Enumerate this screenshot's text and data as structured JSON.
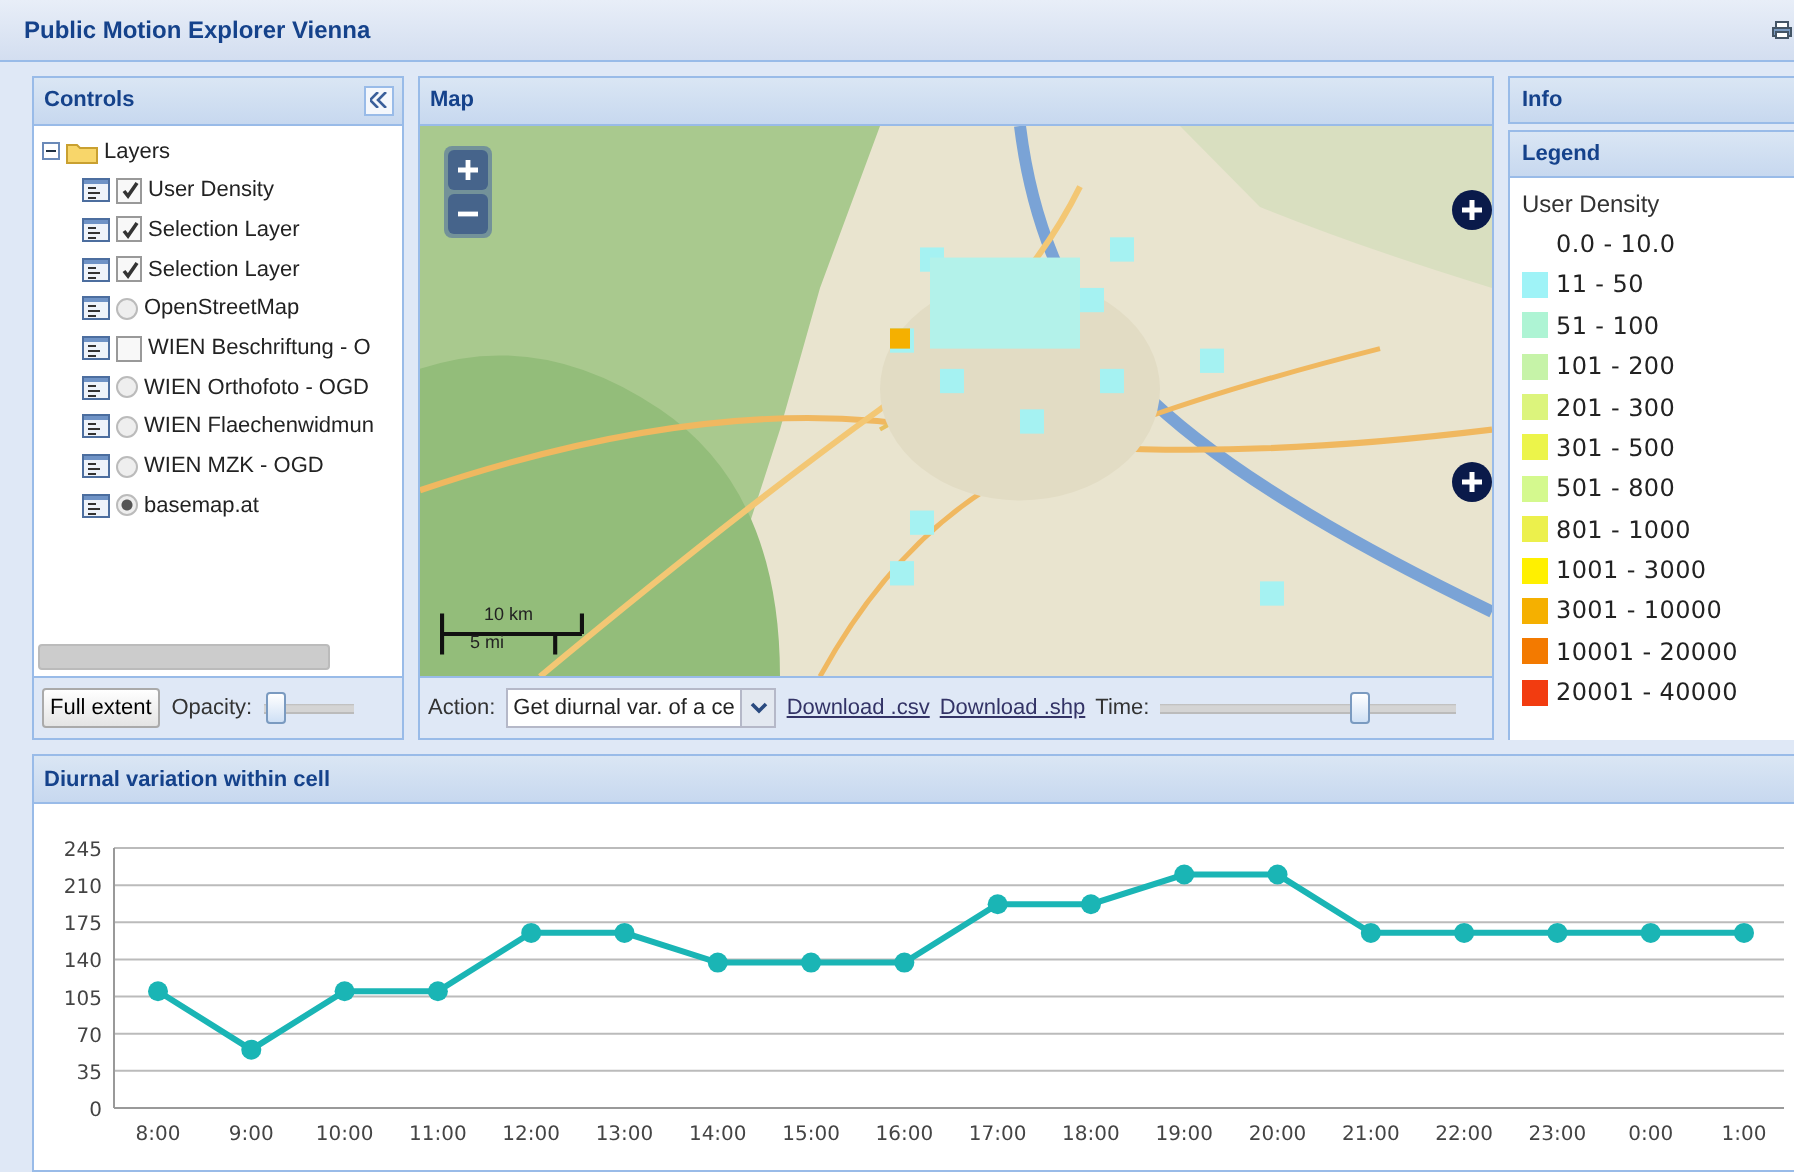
{
  "app_title": "Public Motion Explorer Vienna",
  "controls": {
    "title": "Controls",
    "tree": {
      "label": "Layers",
      "expanded": true,
      "children": [
        {
          "kind": "checkbox",
          "label": "User Density",
          "checked": true
        },
        {
          "kind": "checkbox",
          "label": "Selection Layer",
          "checked": true
        },
        {
          "kind": "checkbox",
          "label": "Selection Layer",
          "checked": true
        },
        {
          "kind": "radio",
          "label": "OpenStreetMap",
          "checked": false
        },
        {
          "kind": "checkbox",
          "label": "WIEN Beschriftung - O",
          "checked": false
        },
        {
          "kind": "radio",
          "label": "WIEN Orthofoto - OGD",
          "checked": false
        },
        {
          "kind": "radio",
          "label": "WIEN Flaechenwidmun",
          "checked": false
        },
        {
          "kind": "radio",
          "label": "WIEN MZK - OGD",
          "checked": false
        },
        {
          "kind": "radio",
          "label": "basemap.at",
          "checked": true
        }
      ]
    },
    "full_extent": "Full extent",
    "opacity_label": "Opacity:",
    "opacity": {
      "level": 0.1
    }
  },
  "map": {
    "title": "Map",
    "scale_km": "10 km",
    "scale_mi": "5 mi",
    "action_label": "Action:",
    "action_value": "Get diurnal var. of a ce",
    "links": [
      "Download .csv",
      "Download .shp"
    ],
    "time_label": "Time:",
    "time": {
      "level": 0.67
    }
  },
  "info": {
    "title": "Info"
  },
  "legend": {
    "title": "Legend",
    "layer": "User Density",
    "items": [
      {
        "label": "0.0 - 10.0"
      },
      {
        "label": "11 - 50",
        "color": "#9ff3f7"
      },
      {
        "label": "51 - 100",
        "color": "#aef4d4"
      },
      {
        "label": "101 - 200",
        "color": "#c6f3a8"
      },
      {
        "label": "201 - 300",
        "color": "#dcf47c"
      },
      {
        "label": "301 - 500",
        "color": "#ecf44a"
      },
      {
        "label": "501 - 800",
        "color": "#d4f98e"
      },
      {
        "label": "801 - 1000",
        "color": "#ecf04c"
      },
      {
        "label": "1001 - 3000",
        "color": "#fff000"
      },
      {
        "label": "3001 - 10000",
        "color": "#f5b000"
      },
      {
        "label": "10001 - 20000",
        "color": "#f37a00"
      },
      {
        "label": "20001 - 40000",
        "color": "#f23c10"
      }
    ]
  },
  "chart_panel": {
    "title": "Diurnal variation within cell",
    "chart_data": {
      "type": "line",
      "categories": [
        "8:00",
        "9:00",
        "10:00",
        "11:00",
        "12:00",
        "13:00",
        "14:00",
        "15:00",
        "16:00",
        "17:00",
        "18:00",
        "19:00",
        "20:00",
        "21:00",
        "22:00",
        "23:00",
        "0:00",
        "1:00"
      ],
      "grid": true,
      "series": [
        {
          "color": "#1ab5b5",
          "marker": true,
          "values": [
            110,
            55,
            110,
            110,
            165,
            165,
            137,
            137,
            137,
            192,
            192,
            220,
            220,
            165,
            165,
            165,
            165,
            165
          ]
        }
      ],
      "ylim": [
        0,
        245
      ],
      "yticks": [
        0,
        35,
        70,
        105,
        140,
        175,
        210,
        245
      ]
    }
  }
}
